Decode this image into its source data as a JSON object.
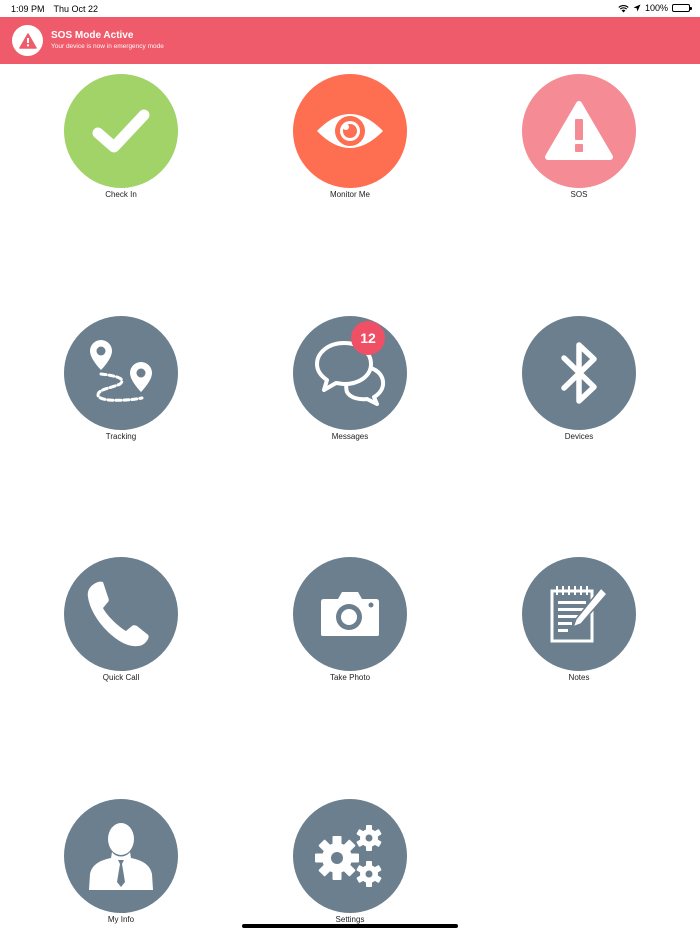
{
  "status_bar": {
    "time": "1:09 PM",
    "date": "Thu Oct 22",
    "battery": "100%"
  },
  "banner": {
    "title": "SOS Mode Active",
    "subtitle": "Your device is now in emergency mode",
    "color": "#ef5b6b"
  },
  "tiles": [
    {
      "label": "Check In",
      "icon": "checkmark-icon",
      "color": "#a1d369"
    },
    {
      "label": "Monitor Me",
      "icon": "eye-icon",
      "color": "#fe6e51"
    },
    {
      "label": "SOS",
      "icon": "warning-icon",
      "color": "#f48b95"
    },
    {
      "label": "Tracking",
      "icon": "route-pins-icon",
      "color": "#6b7f8e"
    },
    {
      "label": "Messages",
      "icon": "chat-bubbles-icon",
      "color": "#6b7f8e",
      "badge": "12"
    },
    {
      "label": "Devices",
      "icon": "bluetooth-icon",
      "color": "#6b7f8e"
    },
    {
      "label": "Quick Call",
      "icon": "phone-icon",
      "color": "#6b7f8e"
    },
    {
      "label": "Take Photo",
      "icon": "camera-icon",
      "color": "#6b7f8e"
    },
    {
      "label": "Notes",
      "icon": "notepad-pencil-icon",
      "color": "#6b7f8e"
    },
    {
      "label": "My Info",
      "icon": "person-icon",
      "color": "#6b7f8e"
    },
    {
      "label": "Settings",
      "icon": "gears-icon",
      "color": "#6b7f8e"
    }
  ]
}
